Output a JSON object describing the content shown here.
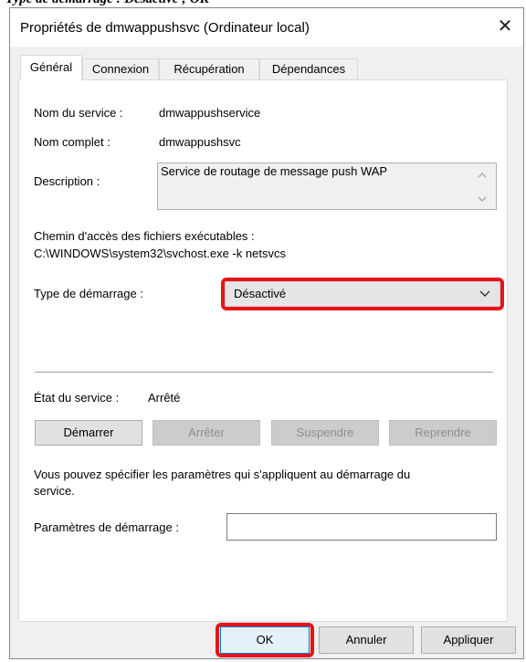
{
  "overlay_caption": "Type de démarrage : Désactivé ; OK",
  "dialog": {
    "title": "Propriétés de dmwappushsvc (Ordinateur local)",
    "close_glyph": "✕"
  },
  "tabs": [
    {
      "label": "Général",
      "active": true
    },
    {
      "label": "Connexion",
      "active": false
    },
    {
      "label": "Récupération",
      "active": false
    },
    {
      "label": "Dépendances",
      "active": false
    }
  ],
  "general": {
    "service_name_label": "Nom du service :",
    "service_name_value": "dmwappushservice",
    "display_name_label": "Nom complet :",
    "display_name_value": "dmwappushsvc",
    "description_label": "Description :",
    "description_value": "Service de routage de message push WAP",
    "path_label": "Chemin d'accès des fichiers exécutables :",
    "path_value": "C:\\WINDOWS\\system32\\svchost.exe -k netsvcs",
    "startup_type_label": "Type de démarrage :",
    "startup_type_value": "Désactivé",
    "status_label": "État du service :",
    "status_value": "Arrêté",
    "buttons": {
      "start": "Démarrer",
      "stop": "Arrêter",
      "pause": "Suspendre",
      "resume": "Reprendre"
    },
    "hint_line1": "Vous pouvez spécifier les paramètres qui s'appliquent au démarrage du",
    "hint_line2": "service.",
    "start_params_label": "Paramètres de démarrage :",
    "start_params_value": ""
  },
  "footer": {
    "ok": "OK",
    "cancel": "Annuler",
    "apply": "Appliquer"
  },
  "colors": {
    "highlight": "#e8131c",
    "panel_bg": "#ffffff",
    "window_bg": "#f0f0f0"
  },
  "icons": {
    "close": "close-icon",
    "dropdown": "chevron-down-icon",
    "scroll_up": "scroll-up-icon",
    "scroll_down": "scroll-down-icon"
  }
}
